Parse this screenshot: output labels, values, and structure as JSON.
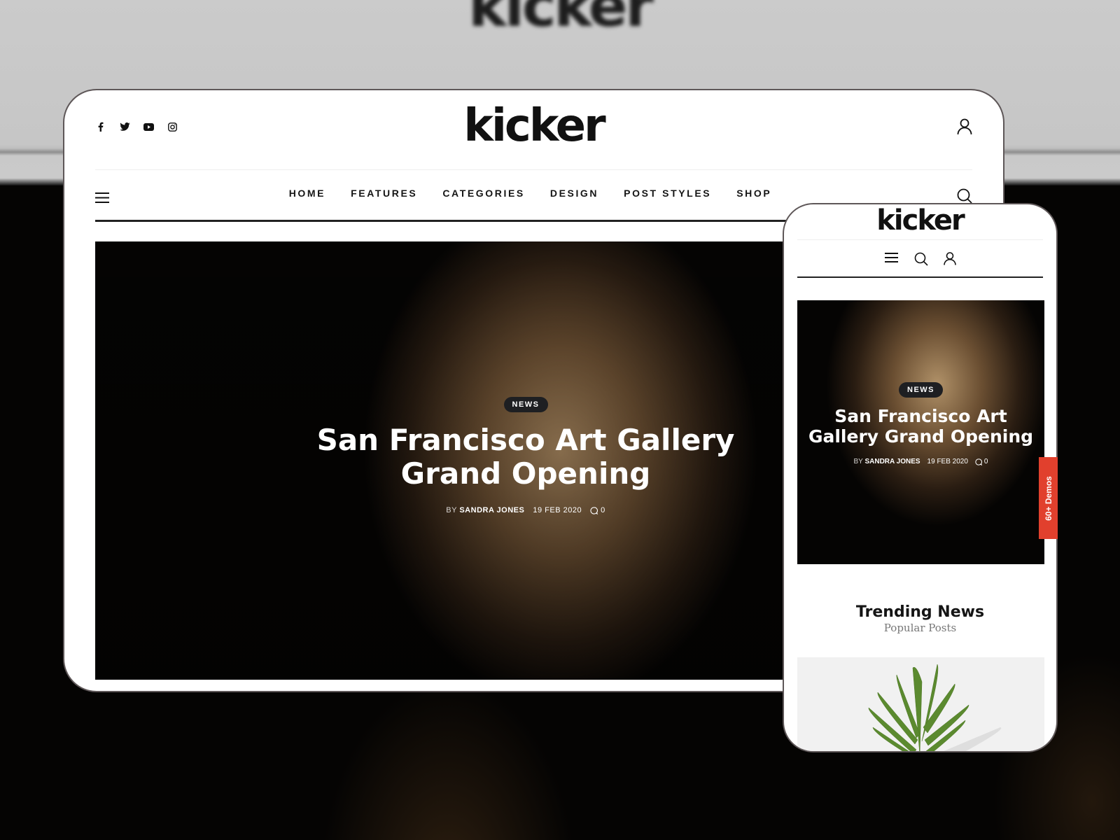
{
  "background": {
    "blurred_logo": "kicker"
  },
  "desktop": {
    "social_icons": [
      "facebook-icon",
      "twitter-icon",
      "youtube-icon",
      "instagram-icon"
    ],
    "logo": "kicker",
    "nav": [
      "HOME",
      "FEATURES",
      "CATEGORIES",
      "DESIGN",
      "POST STYLES",
      "SHOP"
    ],
    "hero": {
      "badge": "NEWS",
      "title_line1": "San Francisco Art Gallery",
      "title_line2": "Grand Opening",
      "by": "BY",
      "author": "SANDRA JONES",
      "date": "19 FEB 2020",
      "comments": "0"
    }
  },
  "phone": {
    "logo": "kicker",
    "hero": {
      "badge": "NEWS",
      "title_line1": "San Francisco Art",
      "title_line2": "Gallery Grand Opening",
      "by": "BY",
      "author": "SANDRA JONES",
      "date": "19 FEB 2020",
      "comments": "0"
    },
    "section_title": "Trending News",
    "section_subtitle": "Popular Posts"
  },
  "demos_tab": {
    "label": "60+ Demos",
    "color": "#e1402d"
  }
}
